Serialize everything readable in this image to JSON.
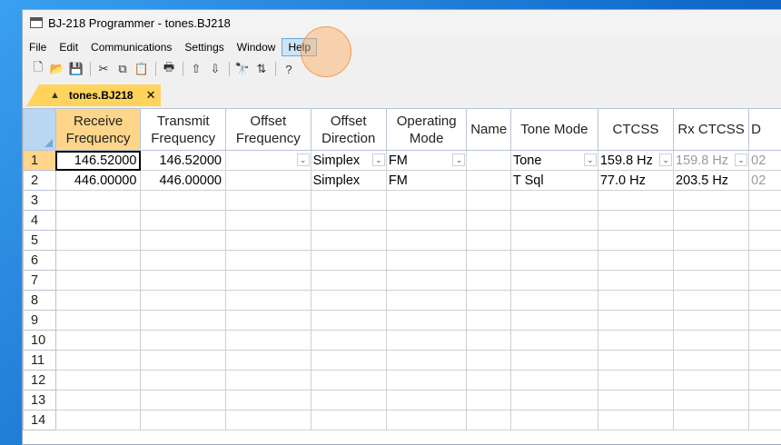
{
  "window": {
    "title": "BJ-218 Programmer - tones.BJ218"
  },
  "menu": [
    "File",
    "Edit",
    "Communications",
    "Settings",
    "Window",
    "Help"
  ],
  "toolbar": [
    {
      "name": "new-icon",
      "glyph": "🗋"
    },
    {
      "name": "open-icon",
      "glyph": "📂"
    },
    {
      "name": "save-icon",
      "glyph": "💾"
    },
    {
      "name": "cut-icon",
      "glyph": "✂"
    },
    {
      "name": "copy-icon",
      "glyph": "⧉"
    },
    {
      "name": "paste-icon",
      "glyph": "📋"
    },
    {
      "name": "print-icon",
      "glyph": "🖶"
    },
    {
      "name": "move-up-icon",
      "glyph": "⇧"
    },
    {
      "name": "move-down-icon",
      "glyph": "⇩"
    },
    {
      "name": "find-icon",
      "glyph": "🔭"
    },
    {
      "name": "sort-az-icon",
      "glyph": "⇅"
    },
    {
      "name": "help-icon",
      "glyph": "?"
    }
  ],
  "tab": {
    "label": "tones.BJ218",
    "close": "✕"
  },
  "columns": [
    "Receive Frequency",
    "Transmit Frequency",
    "Offset Frequency",
    "Offset Direction",
    "Operating Mode",
    "Name",
    "Tone Mode",
    "CTCSS",
    "Rx CTCSS",
    "D"
  ],
  "rows": [
    {
      "n": "1",
      "rx": "146.52000",
      "tx": "146.52000",
      "offset": "",
      "dir": "Simplex",
      "mode": "FM",
      "name": "",
      "tone": "Tone",
      "ctcss": "159.8 Hz",
      "rx_ctcss": "159.8 Hz",
      "dcs": "02"
    },
    {
      "n": "2",
      "rx": "446.00000",
      "tx": "446.00000",
      "offset": "",
      "dir": "Simplex",
      "mode": "FM",
      "name": "",
      "tone": "T Sql",
      "ctcss": "77.0 Hz",
      "rx_ctcss": "203.5 Hz",
      "dcs": "02"
    },
    {
      "n": "3"
    },
    {
      "n": "4"
    },
    {
      "n": "5"
    },
    {
      "n": "6"
    },
    {
      "n": "7"
    },
    {
      "n": "8"
    },
    {
      "n": "9"
    },
    {
      "n": "10"
    },
    {
      "n": "11"
    },
    {
      "n": "12"
    },
    {
      "n": "13"
    },
    {
      "n": "14"
    }
  ],
  "colors": {
    "accent": "#ffd35c",
    "selection": "#ffd58a",
    "menu_highlight": "#cce4f7"
  }
}
